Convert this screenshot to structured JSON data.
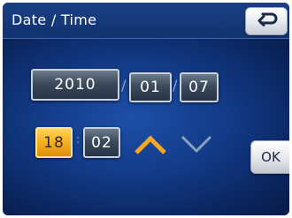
{
  "title": "Date / Time",
  "date": {
    "year": "2010",
    "month": "01",
    "day": "07",
    "separator": "/"
  },
  "time": {
    "hour": "18",
    "minute": "02",
    "separator": ":"
  },
  "ok_label": "OK",
  "icons": {
    "back": "back-return-icon",
    "up": "chevron-up-icon",
    "down": "chevron-down-icon"
  },
  "colors": {
    "active_field": "#f6ad1f",
    "up_arrow": "#f7a823",
    "down_arrow": "#8aa0bf",
    "background": "#123a86"
  }
}
